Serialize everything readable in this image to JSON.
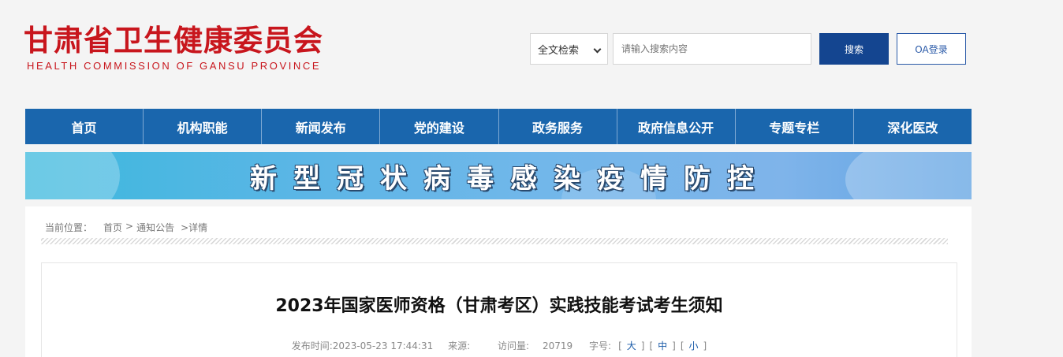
{
  "header": {
    "logo_cn": "甘肃省卫生健康委员会",
    "logo_en": "HEALTH COMMISSION OF GANSU PROVINCE"
  },
  "search": {
    "scope": "全文检索",
    "placeholder": "请输入搜索内容",
    "button": "搜索",
    "oa_button": "OA登录"
  },
  "nav": {
    "items": [
      "首页",
      "机构职能",
      "新闻发布",
      "党的建设",
      "政务服务",
      "政府信息公开",
      "专题专栏",
      "深化医改"
    ]
  },
  "banner": {
    "text": "新型冠状病毒感染疫情防控"
  },
  "breadcrumb": {
    "label": "当前位置：",
    "home": "首页",
    "sep1": ">",
    "section": "通知公告",
    "current": ">详情"
  },
  "article": {
    "title": "2023年国家医师资格（甘肃考区）实践技能考试考生须知",
    "publish_label": "发布时间:",
    "publish_time": "2023-05-23 17:44:31",
    "source_label": "来源:",
    "views_label": "访问量:",
    "views": "20719",
    "fontsize_label": "字号:",
    "fs_large": "大",
    "fs_medium": "中",
    "fs_small": "小"
  },
  "colors": {
    "brand_red": "#c8161d",
    "nav_blue": "#1a66ad",
    "search_blue": "#144590"
  }
}
